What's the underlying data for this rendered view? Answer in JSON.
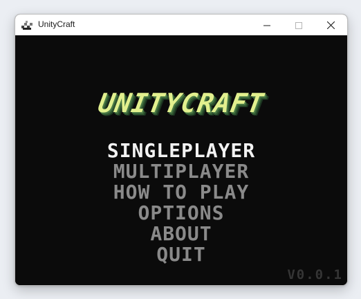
{
  "window": {
    "title": "UnityCraft",
    "icon": "unitycraft-app-icon",
    "controls": [
      "minimize-icon",
      "maximize-icon",
      "close-icon"
    ]
  },
  "game": {
    "logo": "UNITYCRAFT",
    "menu": [
      {
        "label": "SINGLEPLAYER",
        "selected": true
      },
      {
        "label": "MULTIPLAYER",
        "selected": false
      },
      {
        "label": "HOW TO PLAY",
        "selected": false
      },
      {
        "label": "OPTIONS",
        "selected": false
      },
      {
        "label": "ABOUT",
        "selected": false
      },
      {
        "label": "QUIT",
        "selected": false
      }
    ],
    "version": "V0.0.1"
  },
  "colors": {
    "background": "#0b0b0b",
    "logo": "#e2f08e",
    "logo_shadow": "#2f5530",
    "menu_selected": "#f2f2f2",
    "menu_default": "#8a8a8a",
    "version": "#353535"
  }
}
